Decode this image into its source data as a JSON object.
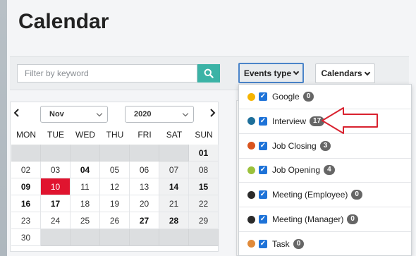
{
  "page": {
    "title": "Calendar"
  },
  "filter": {
    "search_placeholder": "Filter by keyword",
    "events_type_label": "Events type",
    "calendars_label": "Calendars"
  },
  "mini_calendar": {
    "month": "Nov",
    "year": "2020",
    "weekdays": [
      "MON",
      "TUE",
      "WED",
      "THU",
      "FRI",
      "SAT",
      "SUN"
    ],
    "weeks": [
      [
        "",
        "",
        "",
        "",
        "",
        "",
        "01"
      ],
      [
        "02",
        "03",
        "04",
        "05",
        "06",
        "07",
        "08"
      ],
      [
        "09",
        "10",
        "11",
        "12",
        "13",
        "14",
        "15"
      ],
      [
        "16",
        "17",
        "18",
        "19",
        "20",
        "21",
        "22"
      ],
      [
        "23",
        "24",
        "25",
        "26",
        "27",
        "28",
        "29"
      ],
      [
        "30",
        "",
        "",
        "",
        "",
        "",
        ""
      ]
    ],
    "bold_days": [
      "01",
      "04",
      "09",
      "14",
      "15",
      "16",
      "17",
      "27",
      "28"
    ],
    "today": "10",
    "today_color": "#e0142f"
  },
  "events_dropdown": {
    "items": [
      {
        "label": "Google",
        "count": "0",
        "color": "#f5b400",
        "checked": true
      },
      {
        "label": "Interview",
        "count": "17",
        "color": "#1e6f9a",
        "checked": true
      },
      {
        "label": "Job Closing",
        "count": "3",
        "color": "#d9541e",
        "checked": true
      },
      {
        "label": "Job Opening",
        "count": "4",
        "color": "#9bc13c",
        "checked": true
      },
      {
        "label": "Meeting (Employee)",
        "count": "0",
        "color": "#2b2b2b",
        "checked": true
      },
      {
        "label": "Meeting (Manager)",
        "count": "0",
        "color": "#2b2b2b",
        "checked": true
      },
      {
        "label": "Task",
        "count": "0",
        "color": "#e08a3a",
        "checked": true
      }
    ],
    "checkbox_color": "#1e73d8"
  },
  "colors": {
    "accent": "#3bb3a6",
    "annotation_arrow": "#d9222f"
  }
}
